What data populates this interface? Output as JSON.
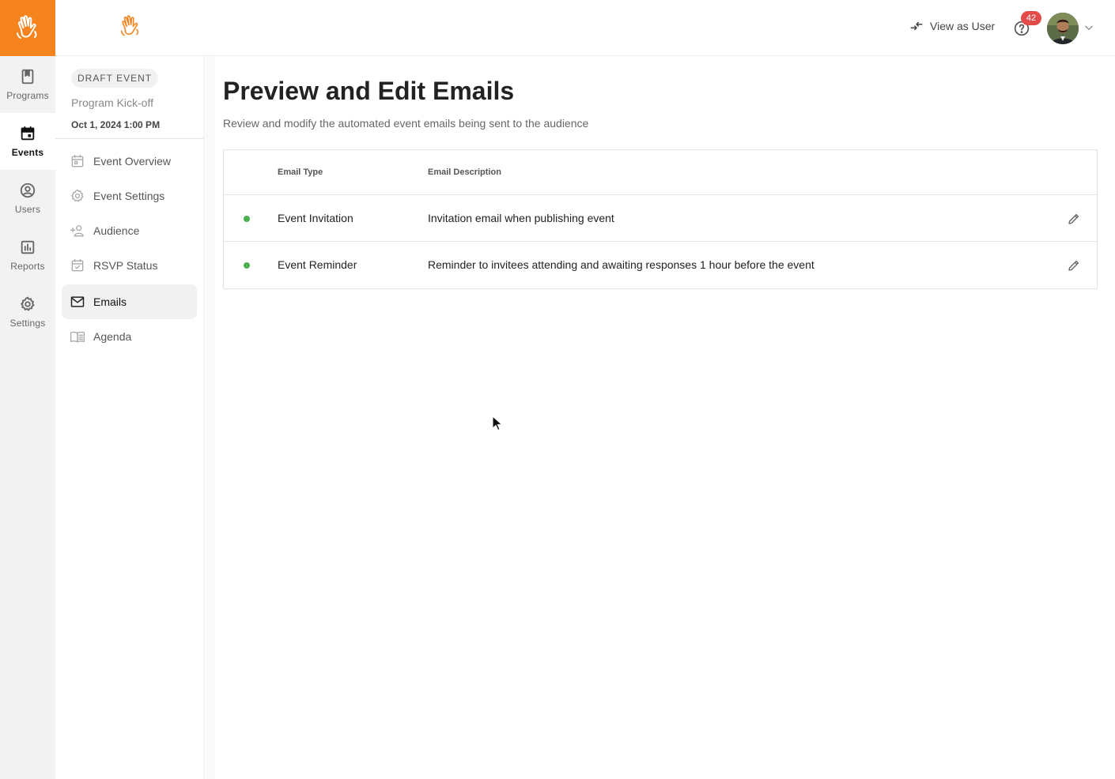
{
  "rail": {
    "items": [
      {
        "label": "Programs",
        "icon": "bookmark-book-icon"
      },
      {
        "label": "Events",
        "icon": "calendar-icon"
      },
      {
        "label": "Users",
        "icon": "user-circle-icon"
      },
      {
        "label": "Reports",
        "icon": "bar-chart-icon"
      },
      {
        "label": "Settings",
        "icon": "gear-icon"
      }
    ],
    "active": "Events"
  },
  "topbar": {
    "view_as_label": "View as User",
    "notification_count": "42"
  },
  "event": {
    "status_chip": "DRAFT EVENT",
    "name": "Program Kick-off",
    "date": "Oct 1, 2024 1:00 PM"
  },
  "subnav": {
    "items": [
      {
        "label": "Event Overview",
        "icon": "calendar-outline-icon"
      },
      {
        "label": "Event Settings",
        "icon": "gear-outline-icon"
      },
      {
        "label": "Audience",
        "icon": "add-person-icon"
      },
      {
        "label": "RSVP Status",
        "icon": "calendar-check-icon"
      },
      {
        "label": "Emails",
        "icon": "mail-icon"
      },
      {
        "label": "Agenda",
        "icon": "open-book-icon"
      }
    ],
    "active": "Emails"
  },
  "main": {
    "title": "Preview and Edit Emails",
    "subtitle": "Review and modify the automated event emails being sent to the audience",
    "table": {
      "headers": [
        "Email Type",
        "Email Description"
      ],
      "rows": [
        {
          "type": "Event Invitation",
          "description": "Invitation email when publishing event",
          "status_color": "#4caf50"
        },
        {
          "type": "Event Reminder",
          "description": "Reminder to invitees attending and awaiting responses 1 hour before the event",
          "status_color": "#4caf50"
        }
      ]
    }
  },
  "colors": {
    "brand": "#f5841f",
    "badge": "#e34b4b",
    "active_status": "#4caf50"
  }
}
